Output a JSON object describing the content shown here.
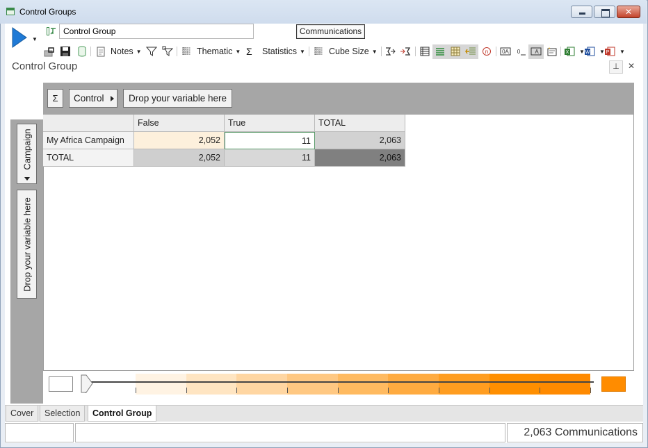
{
  "window": {
    "title": "Control Groups"
  },
  "toolbar": {
    "name_value": "Control Group",
    "communications_label": "Communications",
    "notes_label": "Notes",
    "thematic_label": "Thematic",
    "statistics_label": "Statistics",
    "cube_size_label": "Cube Size"
  },
  "panel": {
    "title": "Control Group"
  },
  "pivot": {
    "sigma_label": "Σ",
    "column_variable": "Control",
    "column_drop_hint": "Drop your variable here",
    "row_variable": "Campaign",
    "row_drop_hint": "Drop your variable here",
    "columns": [
      "False",
      "True",
      "TOTAL"
    ],
    "rows": [
      {
        "label": "My Africa Campaign",
        "values": [
          "2,052",
          "11",
          "2,063"
        ]
      },
      {
        "label": "TOTAL",
        "values": [
          "2,052",
          "11",
          "2,063"
        ]
      }
    ]
  },
  "legend": {
    "swatches": [
      "#fff3e3",
      "#ffe5c2",
      "#ffd6a2",
      "#ffc882",
      "#ffba60",
      "#ffab40",
      "#ff9d20",
      "#ff8f00",
      "#ff8a00"
    ],
    "min_color": "#ffffff",
    "max_color": "#ff8c00"
  },
  "tabs": [
    {
      "label": "Cover",
      "active": false
    },
    {
      "label": "Selection",
      "active": false
    },
    {
      "label": "Control Group",
      "active": true
    }
  ],
  "status": {
    "count_text": "2,063 Communications"
  },
  "colors": {
    "accent_blue": "#1f7ad6",
    "cell_highlight": "#fdf0dc",
    "total_dark": "#808080"
  }
}
